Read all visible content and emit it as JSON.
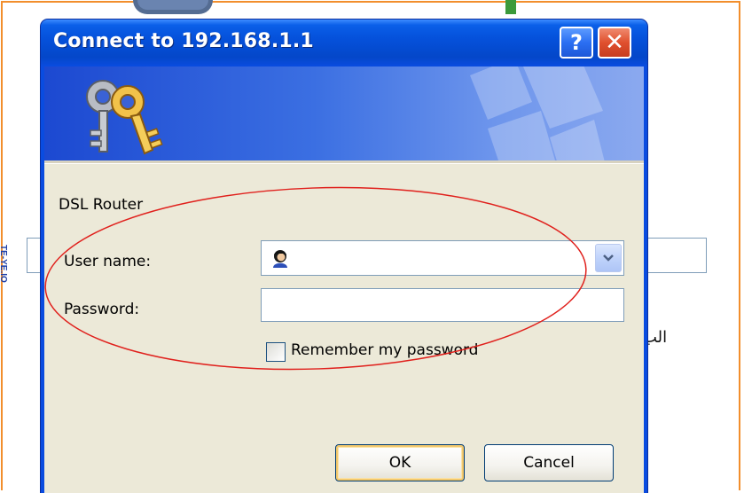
{
  "background": {
    "vertical_text": "TE-YE.IO",
    "arabic_text": "الب"
  },
  "dialog": {
    "title": "Connect to 192.168.1.1",
    "help_label": "?",
    "close_label": "✕",
    "realm": "DSL Router",
    "username_label": "User name:",
    "username_value": "",
    "password_label": "Password:",
    "password_value": "",
    "remember_label": "Remember my password",
    "remember_checked": false,
    "ok_label": "OK",
    "cancel_label": "Cancel"
  },
  "icons": {
    "banner": "keys-icon",
    "user": "user-icon",
    "dropdown": "chevron-down-icon"
  },
  "colors": {
    "titlebar": "#0a4ce0",
    "client": "#ece9d8",
    "highlight_ellipse": "#e0201c",
    "page_frame": "#f28e2c"
  }
}
